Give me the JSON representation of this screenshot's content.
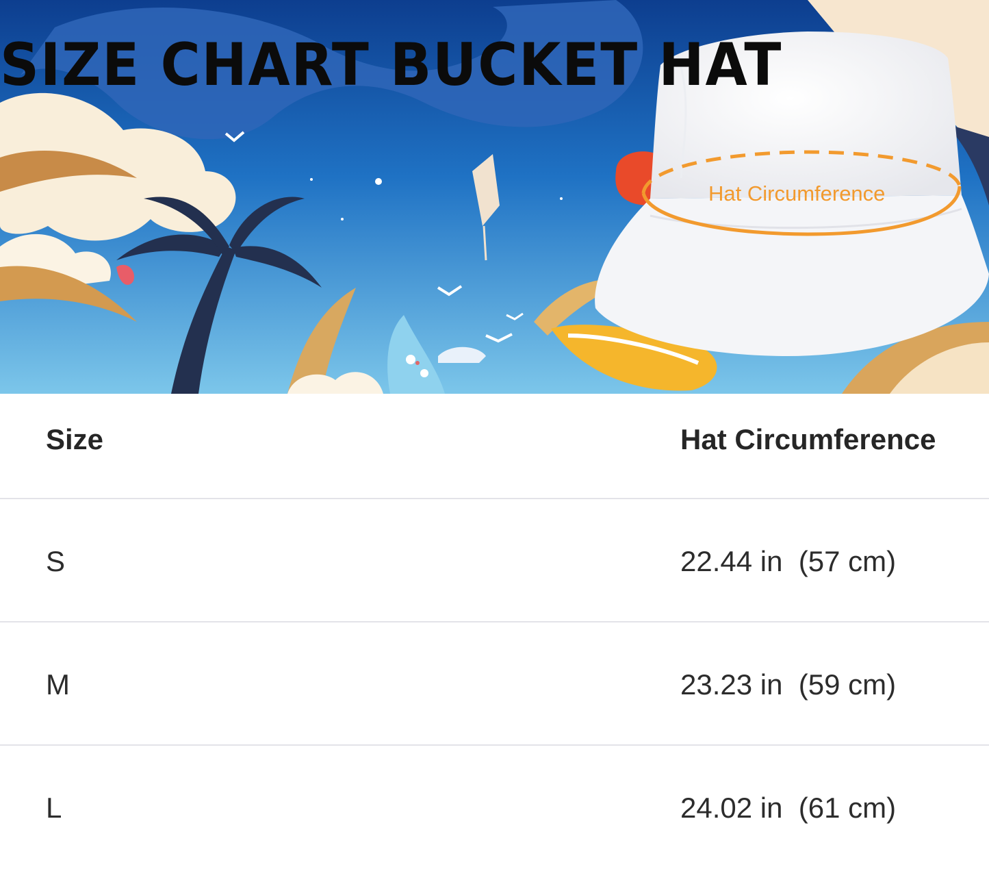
{
  "banner": {
    "title": "SIZE CHART BUCKET HAT",
    "hat_label": "Hat Circumference",
    "colors": {
      "sky": "#2e83c7",
      "deep_blue": "#0d3e8f",
      "accent_orange": "#f29a2e"
    }
  },
  "table": {
    "headers": [
      "Size",
      "Hat Circumference"
    ],
    "rows": [
      {
        "size": "S",
        "circumference": "22.44 in  (57 cm)"
      },
      {
        "size": "M",
        "circumference": "23.23 in  (59 cm)"
      },
      {
        "size": "L",
        "circumference": "24.02 in  (61 cm)"
      }
    ]
  }
}
